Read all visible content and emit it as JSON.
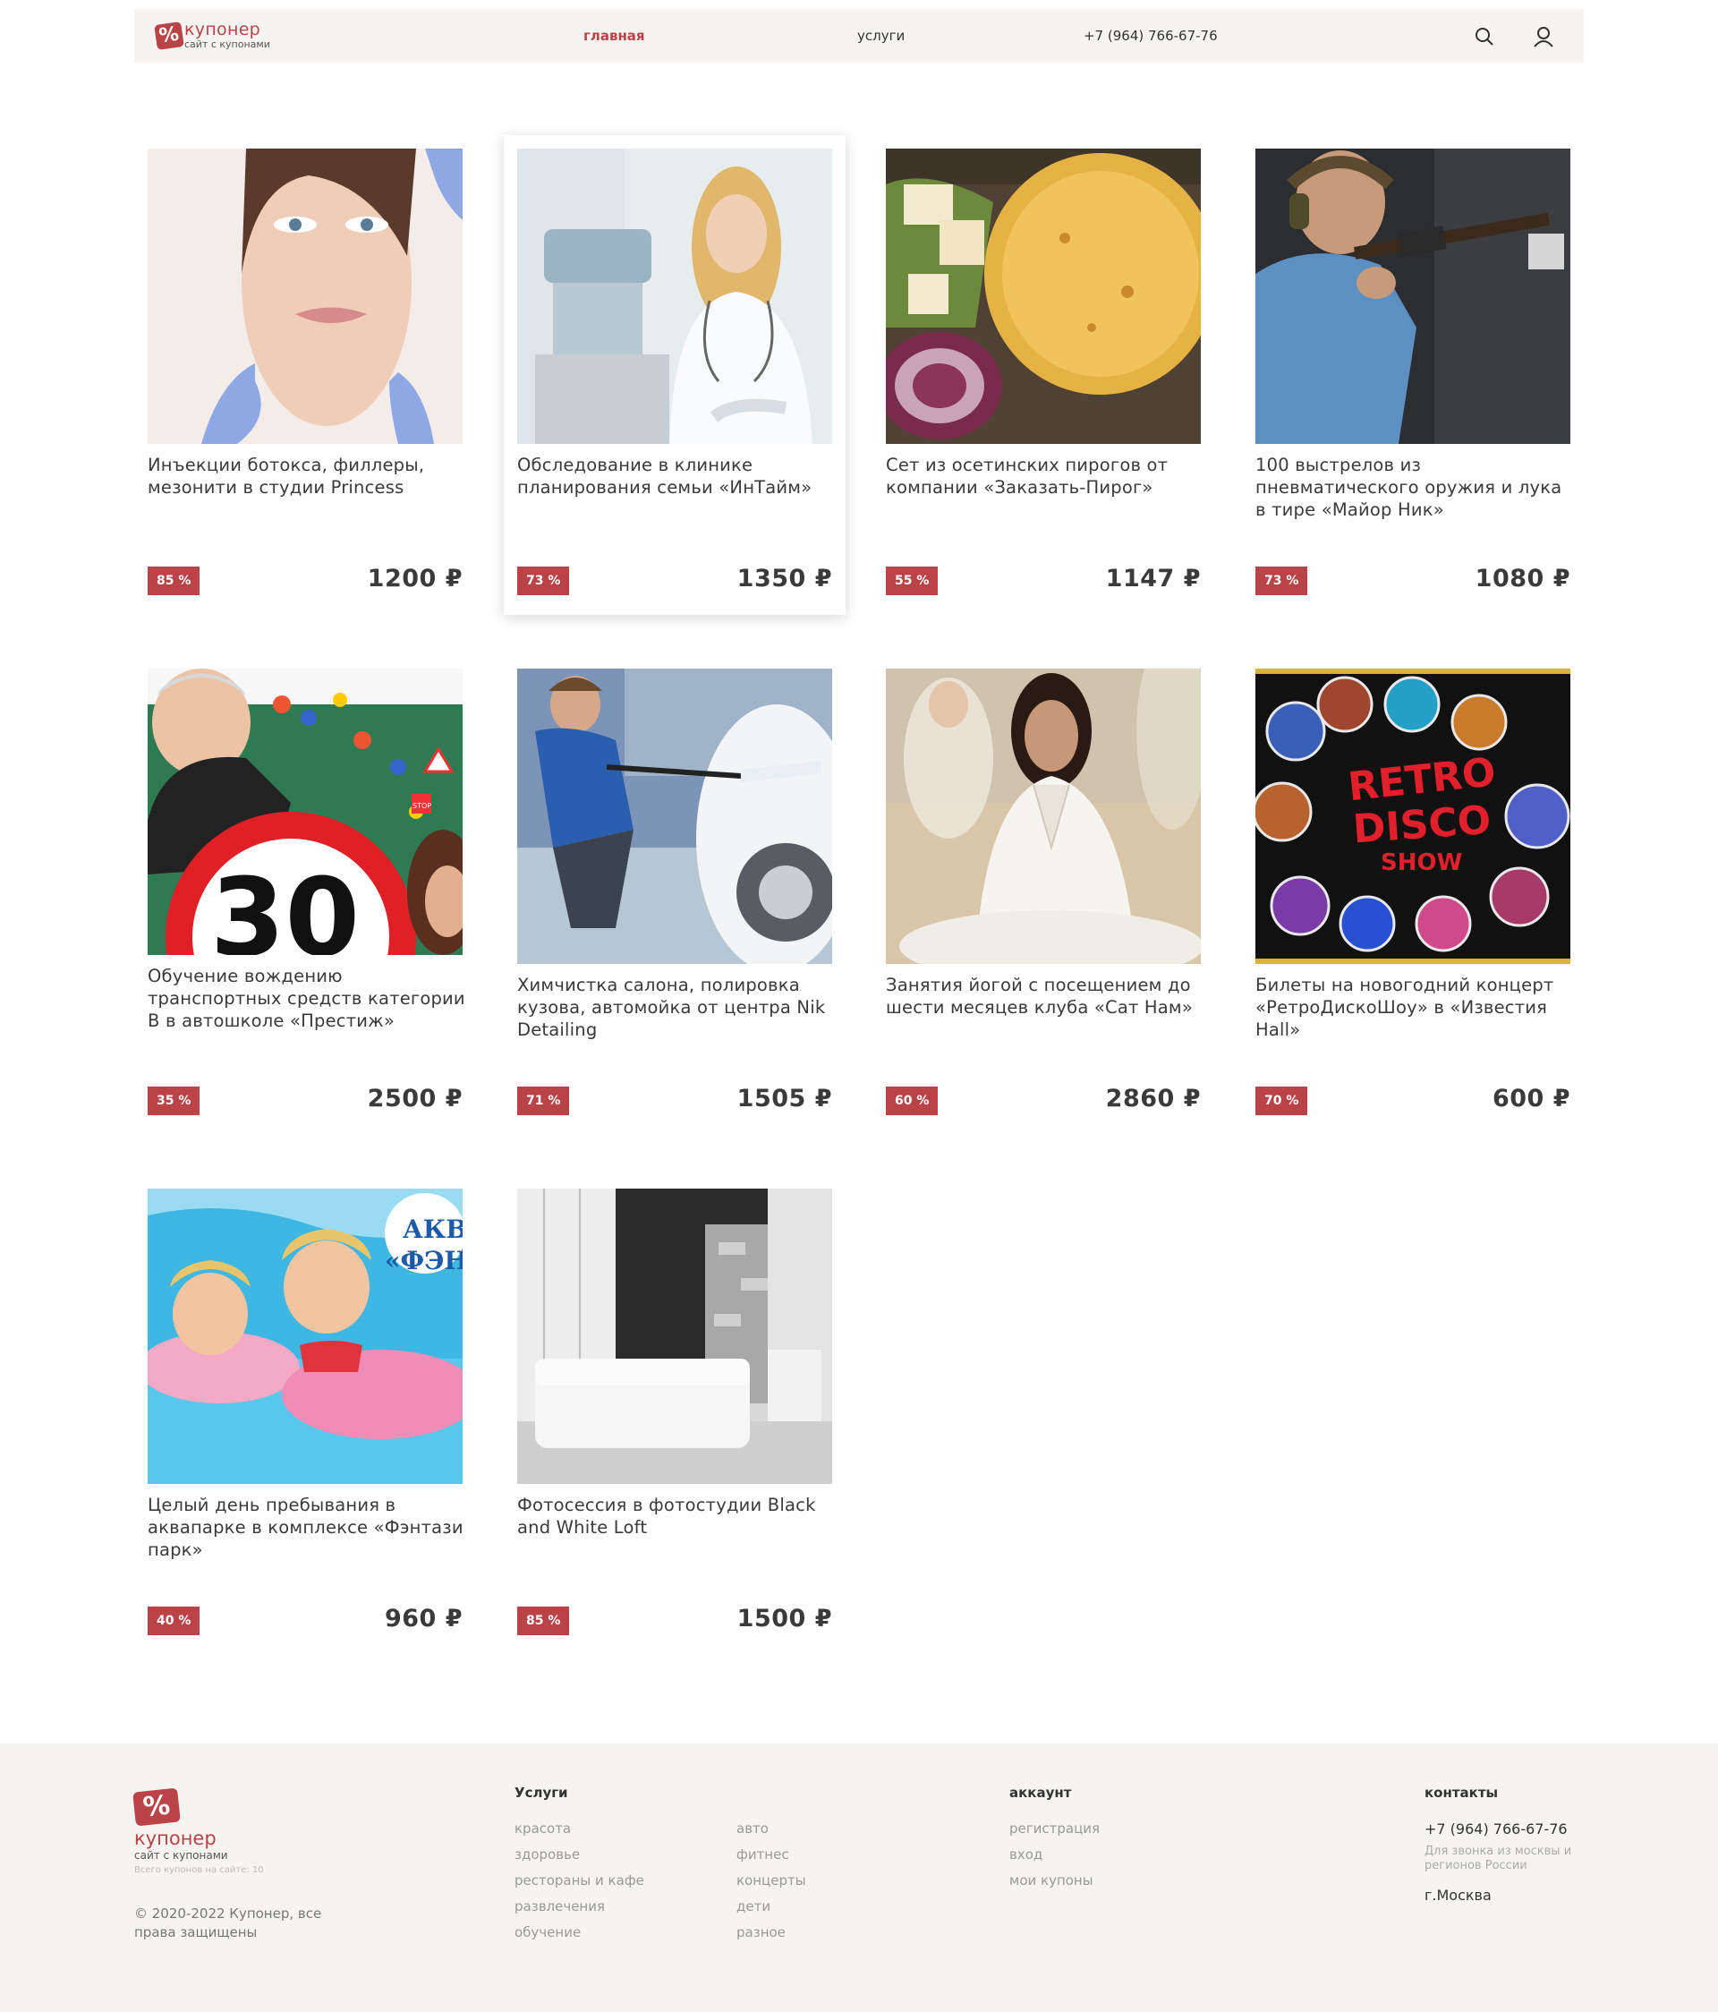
{
  "header": {
    "logo_name": "купонер",
    "logo_sub": "сайт с купонами",
    "logo_mark": "%",
    "nav": [
      "главная",
      "услуги",
      "+7 (964) 766-67-76"
    ],
    "search_icon": "search-icon",
    "user_icon": "user-icon"
  },
  "colors": {
    "accent": "#b94346",
    "header_bg": "#f5f4f1",
    "footer_bg": "#f5f4f1"
  },
  "coupons": [
    {
      "title": "Инъекции ботокса, филлеры, мезонити в студии Princess",
      "discount": "85 %",
      "price": "1200 ₽"
    },
    {
      "title": "Обследование в клинике планирования семьи «ИнТайм»",
      "discount": "73 %",
      "price": "1350 ₽"
    },
    {
      "title": "Сет из осетинских пирогов от компании «Заказать-Пирог»",
      "discount": "55 %",
      "price": "1147 ₽"
    },
    {
      "title": "100 выстрелов из пневматического оружия и лука в тире «Майор Ник»",
      "discount": "73 %",
      "price": "1080 ₽"
    },
    {
      "title": "Обучение вождению транспортных средств категории B в автошколе «Престиж»",
      "discount": "35 %",
      "price": "2500 ₽"
    },
    {
      "title": "Химчистка салона, полировка кузова, автомойка от центра Nik Detailing",
      "discount": "71 %",
      "price": "1505 ₽"
    },
    {
      "title": "Занятия йогой с посещением до шести месяцев клуба «Сат Нам»",
      "discount": "60 %",
      "price": "2860 ₽"
    },
    {
      "title": "Билеты на новогодний концерт «РетроДискоШоу» в «Известия Hall»",
      "discount": "70 %",
      "price": "600 ₽"
    },
    {
      "title": "Целый день пребывания в аквапарке в комплексе «Фэнтази парк»",
      "discount": "40 %",
      "price": "960 ₽"
    },
    {
      "title": "Фотосессия в фотостудии Black and White Loft",
      "discount": "85 %",
      "price": "1500 ₽"
    }
  ],
  "image_text": {
    "speed_sign": "30",
    "stop_sign": "STOP",
    "retro": "RETRO",
    "disco": "DISCO",
    "show": "SHOW",
    "aqua": "АКВА",
    "fantasy": "«ФЭН"
  },
  "footer": {
    "logo_name": "купонер",
    "logo_sub": "сайт с купонами",
    "count": "Всего купонов на сайте: 10",
    "copyright": "© 2020-2022 Купонер, все права защищены",
    "services_head": "Услуги",
    "services_col1": [
      "красота",
      "здоровье",
      "рестораны и кафе",
      "развлечения",
      "обучение"
    ],
    "services_col2": [
      "авто",
      "фитнес",
      "концерты",
      "дети",
      "разное"
    ],
    "account_head": "аккаунт",
    "account_links": [
      "регистрация",
      "вход",
      "мои купоны"
    ],
    "contacts_head": "контакты",
    "phone": "+7 (964) 766-67-76",
    "phone_note": "Для звонка из москвы и регионов России",
    "city": "г.Москва"
  }
}
